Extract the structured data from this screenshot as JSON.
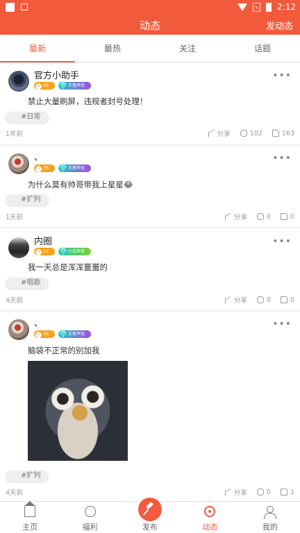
{
  "app": {
    "title": "动态",
    "action": "发动态",
    "clock": "2:12",
    "accent": "#f25a3c"
  },
  "tabs": [
    {
      "label": "最新",
      "active": true
    },
    {
      "label": "最热",
      "active": false
    },
    {
      "label": "关注",
      "active": false
    },
    {
      "label": "话题",
      "active": false
    }
  ],
  "posts": [
    {
      "user": "官方小助手",
      "level_tag": "LV",
      "level": "05",
      "honor": "王者声优",
      "text": "禁止大量刷屏，违规者封号处理！",
      "tag": "#日常",
      "time": "1年前",
      "share": "分享",
      "comments": "102",
      "likes": "163"
    },
    {
      "user": "、",
      "level_tag": "LV",
      "level": "35",
      "honor": "王者声优",
      "text": "为什么莫有帅哥带我上星星😂",
      "tag": "#扩列",
      "time": "1天前",
      "share": "分享",
      "comments": "0",
      "likes": "0"
    },
    {
      "user": "内圈",
      "level_tag": "LV",
      "level": "01",
      "honor": "小白声优",
      "text": "我一天总是浑浑噩噩的",
      "tag": "#唱歌",
      "time": "4天前",
      "share": "分享",
      "comments": "0",
      "likes": "0"
    },
    {
      "user": "、",
      "level_tag": "LV",
      "level": "35",
      "honor": "王者声优",
      "text": "脑袋不正常的别加我",
      "tag": "#扩列",
      "time": "4天前",
      "share": "分享",
      "comments": "0",
      "likes": "1"
    }
  ],
  "more_glyph": "•••",
  "nav": [
    {
      "label": "主页",
      "icon": "home-icon"
    },
    {
      "label": "福利",
      "icon": "money-bag-icon"
    },
    {
      "label": "发布",
      "icon": "microphone-icon"
    },
    {
      "label": "动态",
      "icon": "radar-icon",
      "active": true
    },
    {
      "label": "我的",
      "icon": "user-icon"
    }
  ]
}
